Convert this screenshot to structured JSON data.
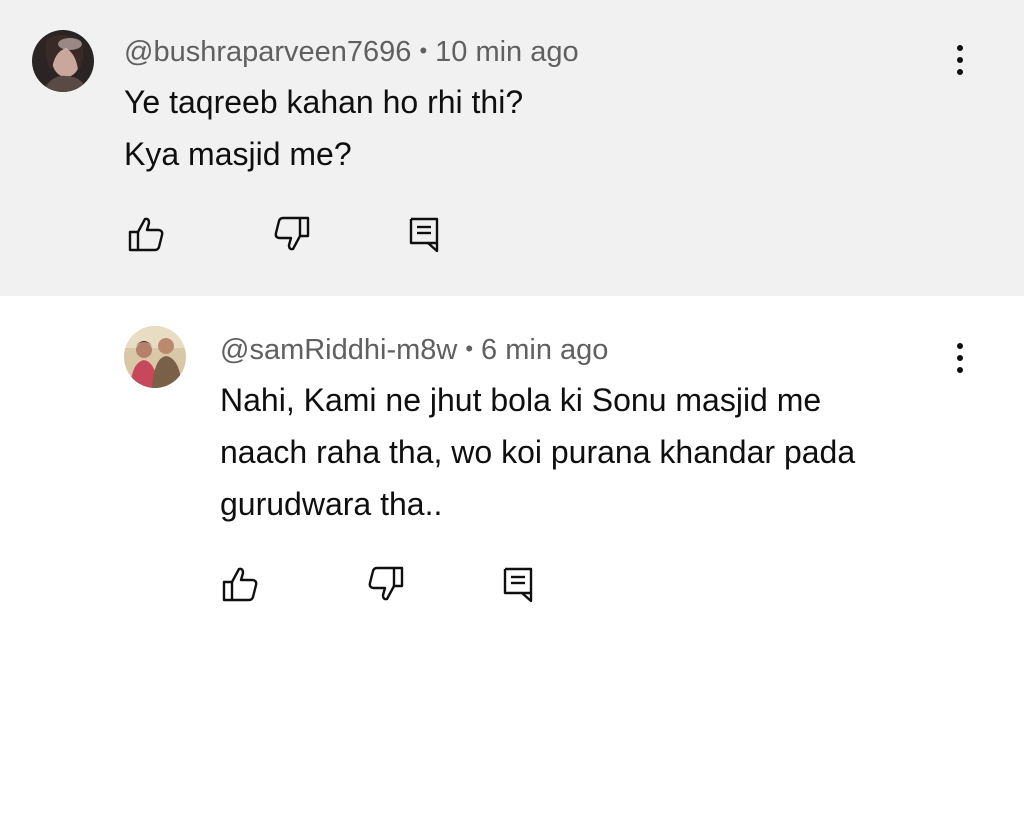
{
  "comments": [
    {
      "username": "@bushraparveen7696",
      "separator": "•",
      "time": "10 min ago",
      "lines": [
        "Ye taqreeb kahan ho rhi thi?",
        "Kya masjid me?"
      ],
      "avatar_icon": "profile-photo-woman",
      "actions": [
        "like-icon",
        "dislike-icon",
        "reply-icon"
      ]
    },
    {
      "username": "@samRiddhi-m8w",
      "separator": "•",
      "time": "6 min ago",
      "lines": [
        "Nahi, Kami ne jhut bola ki Sonu masjid me",
        "naach raha tha, wo koi purana khandar pada",
        "gurudwara tha.."
      ],
      "avatar_icon": "profile-photo-couple",
      "actions": [
        "like-icon",
        "dislike-icon",
        "reply-icon"
      ]
    }
  ],
  "colors": {
    "highlight_bg": "#f1f1f1",
    "meta_text": "#606060",
    "body_text": "#0f0f0f"
  }
}
